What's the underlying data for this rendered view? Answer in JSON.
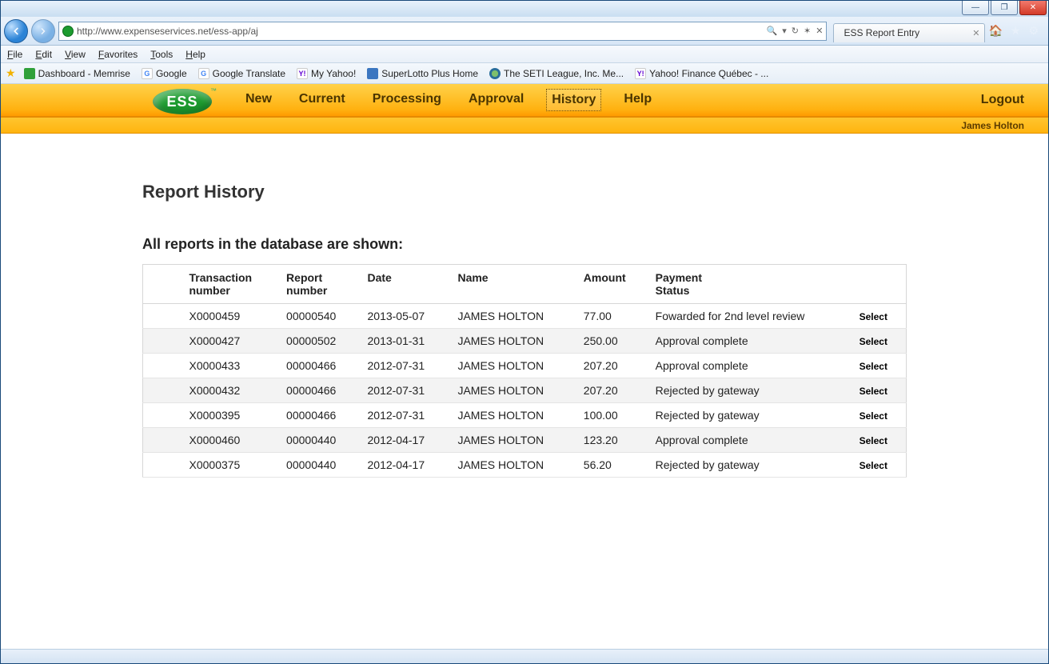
{
  "window": {
    "btn_min": "—",
    "btn_max": "❐",
    "btn_close": "✕"
  },
  "ie": {
    "url": "http://www.expenseservices.net/ess-app/aj",
    "search_glyph": "🔍",
    "tab_title": "ESS Report Entry",
    "right_tools": {
      "home": "🏠",
      "star": "★",
      "gear": "⚙"
    }
  },
  "menubar": [
    "File",
    "Edit",
    "View",
    "Favorites",
    "Tools",
    "Help"
  ],
  "favorites": [
    {
      "icon": "fi-green",
      "label": "Dashboard - Memrise"
    },
    {
      "icon": "fi-g",
      "glyph": "G",
      "label": "Google"
    },
    {
      "icon": "fi-g",
      "glyph": "G",
      "label": "Google Translate"
    },
    {
      "icon": "fi-y",
      "glyph": "Y!",
      "label": "My Yahoo!"
    },
    {
      "icon": "fi-blue",
      "label": "SuperLotto Plus Home"
    },
    {
      "icon": "fi-globe",
      "label": "The SETI League, Inc. Me..."
    },
    {
      "icon": "fi-y",
      "glyph": "Y!",
      "label": "Yahoo! Finance Québec - ..."
    }
  ],
  "ess": {
    "nav": [
      "New",
      "Current",
      "Processing",
      "Approval",
      "History",
      "Help"
    ],
    "active_nav": "History",
    "logout": "Logout",
    "user": "James Holton"
  },
  "page": {
    "title": "Report History",
    "subhead": "All reports in the database are shown:",
    "columns": [
      "",
      "Transaction number",
      "Report number",
      "Date",
      "Name",
      "Amount",
      "Payment Status",
      ""
    ],
    "select_label": "Select",
    "rows": [
      {
        "txn": "X0000459",
        "rpt": "00000540",
        "date": "2013-05-07",
        "name": "JAMES HOLTON",
        "amount": "77.00",
        "status": "Fowarded for 2nd level review"
      },
      {
        "txn": "X0000427",
        "rpt": "00000502",
        "date": "2013-01-31",
        "name": "JAMES HOLTON",
        "amount": "250.00",
        "status": "Approval complete"
      },
      {
        "txn": "X0000433",
        "rpt": "00000466",
        "date": "2012-07-31",
        "name": "JAMES HOLTON",
        "amount": "207.20",
        "status": "Approval complete"
      },
      {
        "txn": "X0000432",
        "rpt": "00000466",
        "date": "2012-07-31",
        "name": "JAMES HOLTON",
        "amount": "207.20",
        "status": "Rejected by gateway"
      },
      {
        "txn": "X0000395",
        "rpt": "00000466",
        "date": "2012-07-31",
        "name": "JAMES HOLTON",
        "amount": "100.00",
        "status": "Rejected by gateway"
      },
      {
        "txn": "X0000460",
        "rpt": "00000440",
        "date": "2012-04-17",
        "name": "JAMES HOLTON",
        "amount": "123.20",
        "status": "Approval complete"
      },
      {
        "txn": "X0000375",
        "rpt": "00000440",
        "date": "2012-04-17",
        "name": "JAMES HOLTON",
        "amount": "56.20",
        "status": "Rejected by gateway"
      }
    ]
  }
}
